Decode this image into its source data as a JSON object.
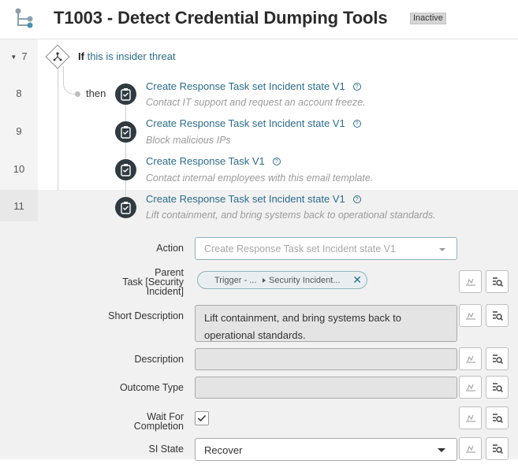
{
  "header": {
    "title": "T1003 - Detect Credential Dumping Tools",
    "status": "Inactive"
  },
  "flow": {
    "if_row": {
      "number": "7",
      "keyword": "If",
      "condition": "this is insider threat"
    },
    "then_label": "then",
    "steps": [
      {
        "number": "8",
        "title": "Create Response Task set Incident state V1",
        "subtitle": "Contact IT support and request an account freeze."
      },
      {
        "number": "9",
        "title": "Create Response Task set Incident state V1",
        "subtitle": "Block malicious IPs"
      },
      {
        "number": "10",
        "title": "Create Response Task V1",
        "subtitle": "Contact internal employees with this email template."
      },
      {
        "number": "11",
        "title": "Create Response Task set Incident state V1",
        "subtitle": "Lift containment, and bring systems back to operational standards."
      }
    ]
  },
  "form": {
    "action": {
      "label": "Action",
      "value": "Create Response Task set Incident state V1"
    },
    "parent_task": {
      "label_line1": "Parent",
      "label_line2": "Task [Security",
      "label_line3": "Incident]",
      "pill_part1": "Trigger - ...",
      "pill_part2": "Security Incident..."
    },
    "short_description": {
      "label": "Short Description",
      "value_line1": "Lift containment, and bring systems back to",
      "value_line2": "operational standards."
    },
    "description": {
      "label": "Description",
      "value": ""
    },
    "outcome_type": {
      "label": "Outcome Type",
      "value": ""
    },
    "wait_for_completion": {
      "label_line1": "Wait For",
      "label_line2": "Completion",
      "checked": true
    },
    "si_state": {
      "label": "SI State",
      "value": "Recover"
    }
  },
  "colors": {
    "link": "#2b6c8a",
    "step_icon_bg": "#2f3b40",
    "panel_bg": "#f1f1f1",
    "badge_bg": "#d6d6d6"
  },
  "icons": {
    "app": "flow-designer-icon",
    "if": "branch-icon",
    "step": "task-icon",
    "help": "help-circle-icon",
    "data_pill_picker": "data-pill-icon",
    "explore": "explore-icon"
  }
}
